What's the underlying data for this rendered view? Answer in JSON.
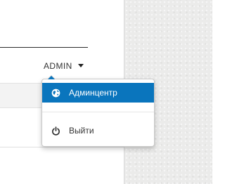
{
  "header": {
    "user_label": "ADMIN",
    "caret_icon": "caret-down-icon"
  },
  "dropdown": {
    "items": [
      {
        "label": "Админцентр",
        "icon": "globe-icon",
        "active": true
      },
      {
        "label": "Выйти",
        "icon": "power-icon",
        "active": false
      }
    ]
  },
  "colors": {
    "accent": "#0a75bd",
    "text": "#333333",
    "right_background": "#ebebea"
  }
}
